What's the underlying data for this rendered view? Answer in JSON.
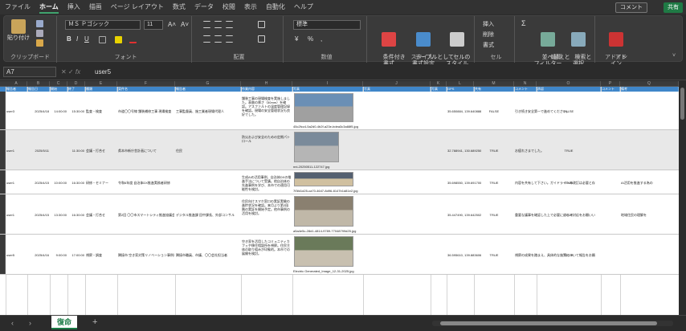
{
  "menu": {
    "tabs": [
      "ファイル",
      "ホーム",
      "挿入",
      "描画",
      "ページ レイアウト",
      "数式",
      "データ",
      "校閲",
      "表示",
      "自動化",
      "ヘルプ"
    ],
    "active": "ホーム",
    "comment": "コメント",
    "share": "共有"
  },
  "ribbon": {
    "clipboard": {
      "paste": "貼り付け",
      "label": "クリップボード"
    },
    "font": {
      "name": "ＭＳ Ｐゴシック",
      "size": "11",
      "label": "フォント"
    },
    "alignment": {
      "label": "配置"
    },
    "number": {
      "format": "標準",
      "label": "数値"
    },
    "styles": {
      "conditional": "条件付き\n書式",
      "table": "テーブルとして\n書式設定",
      "cell": "セルの\nスタイル",
      "label": "スタイル"
    },
    "cells": {
      "insert": "挿入",
      "delete": "削除",
      "format": "書式",
      "label": "セル"
    },
    "editing": {
      "sort": "並べ替えと\nフィルター",
      "find": "検索と\n選択",
      "label": "編集"
    },
    "addins": {
      "addin": "アド\nイン",
      "label": "アドイン"
    }
  },
  "formula": {
    "namebox": "A7",
    "value": "user5"
  },
  "columns": [
    "A",
    "B",
    "C",
    "D",
    "E",
    "F",
    "G",
    "H",
    "I",
    "J",
    "K",
    "L",
    "M",
    "N",
    "O",
    "P",
    "Q"
  ],
  "header_labels": [
    "報告者",
    "報告日",
    "開始",
    "終了",
    "種類",
    "案件名",
    "報告者",
    "作業内容",
    "写真",
    "写真",
    "写真",
    "GPS",
    "共有",
    "コメント",
    "承認",
    "コメント",
    "備考"
  ],
  "rows": [
    {
      "a": "user3",
      "b": "2025/4/18",
      "c": "14:00:00",
      "d": "15:30:00",
      "e": "監査・検査",
      "f": "市道〇〇号線 舗装補修工事 現場検査",
      "g": "工事監督員、施工業者現場代理人",
      "h": "舗装工事の現場検査を実施しました。表層の厚さ（50mm）を確認。アスファルトの温度管理記録を確認。現場の安全管理状況も良好でした。",
      "i": "45c2fcc4-5a2d0-4b2f-a23e-bdea3c3a88f5.jpg",
      "l": "35.650884, 139.640888",
      "m": "FALSE",
      "n": "引き続き安全第一で進めてください。",
      "o": "FALSE"
    },
    {
      "a": "user1",
      "b": "2025/5/11",
      "c": "",
      "d": "11:30:00",
      "e": "会議・打合せ",
      "f": "県本市新庁舎計画について",
      "g": "住民",
      "h": "防災および安全のための定期パトロール",
      "i": "nni-20250511-122747.jpg",
      "l": "32.788941, 130.689250",
      "m": "TRUE",
      "n": "お疲れさまでした。",
      "o": "TRUE"
    },
    {
      "a": "user1",
      "b": "2025/4/15",
      "c": "10:00:00",
      "d": "16:30:00",
      "e": "研修・セミナー",
      "f": "令和6年度 自治体DX推進実務者研修",
      "g": "",
      "h": "生成AIの活用事例、自治体DXの推進手法について受講。他自治体の先進事例を学び、本市での適用可能性を検討。",
      "i": "7f3fd1d25-ca70-4647-8d96-8147b1d81e2.jpg",
      "l": "35.698550, 139.691700",
      "m": "TRUE",
      "n": "内容を共有して下さい。ガイドラインの改訂は必要と存じます。",
      "o": "TRUE",
      "q": "AI活用を推進する為の"
    },
    {
      "a": "user1",
      "b": "2025/4/15",
      "c": "13:30:00",
      "d": "16:30:00",
      "e": "会議・打合せ",
      "f": "第2回 〇〇市スマートシティ推進協議会",
      "g": "デジタル推進課 田中課長、外部コンサル",
      "h": "住民向けスマホ窓口の実証実験の進捗状況を確認。来月より第2段階の実証を開始予定。他市事例の活用を検討。",
      "i": "a5a4e5c-28d1-4814-9789-77048799d25.jpg",
      "l": "35.447490, 139.642502",
      "m": "TRUE",
      "n": "重要な議事を確認した上で必要に応じて対応をお願いいたします。",
      "o": "TRUE",
      "q": "地域住民の理解を"
    },
    {
      "a": "user5",
      "b": "2025/4/16",
      "c": "9:00:00",
      "d": "17:00:00",
      "e": "視察・調査",
      "f": "隣接市 空き家対策リノベーション事例視察",
      "g": "隣接市職員、市議、〇〇会社担当者",
      "h": "空き家を活用したコミュニティカフェや移住相談所を視察。住民主体の取り組みが印象的。本市での展開を検討。",
      "i": "Electric Generated_Image_12-31-2025.jpg",
      "l": "36.595610, 139.883606",
      "m": "TRUE",
      "n": "視察の成果を踏まえ、具体的な施策について報告をお願いいたします。",
      "o": "TRUE"
    }
  ]
}
